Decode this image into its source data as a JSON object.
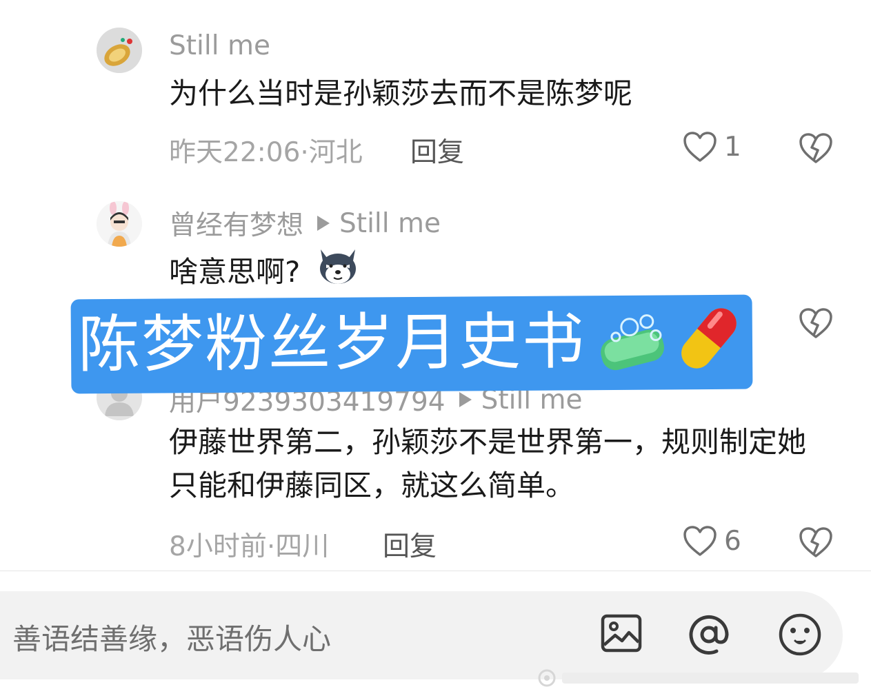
{
  "comments": [
    {
      "username": "Still me",
      "reply_to": "",
      "text": "为什么当时是孙颖莎去而不是陈梦呢",
      "meta": "昨天22:06·河北",
      "reply_label": "回复",
      "likes": "1"
    },
    {
      "username": "曾经有梦想",
      "reply_to": "Still me",
      "text": "啥意思啊?",
      "meta": "",
      "reply_label": "",
      "likes": ""
    },
    {
      "username": "用户9239303419794",
      "reply_to": "Still me",
      "text": "伊藤世界第二，孙颖莎不是世界第一，规则制定她只能和伊藤同区，就这么简单。",
      "meta": "8小时前·四川",
      "reply_label": "回复",
      "likes": "6"
    }
  ],
  "banner": {
    "text": "陈梦粉丝岁月史书"
  },
  "input": {
    "placeholder": "善语结善缘，恶语伤人心"
  },
  "icons": [
    "heart-icon",
    "broken-heart-icon",
    "image-icon",
    "at-icon",
    "emoji-icon",
    "dog-emoji-icon",
    "soap-emoji-icon",
    "pill-emoji-icon"
  ],
  "colors": {
    "banner_bg": "#3e97ef",
    "muted_text": "#9b9b9b",
    "input_bg": "#f2f2f2"
  }
}
